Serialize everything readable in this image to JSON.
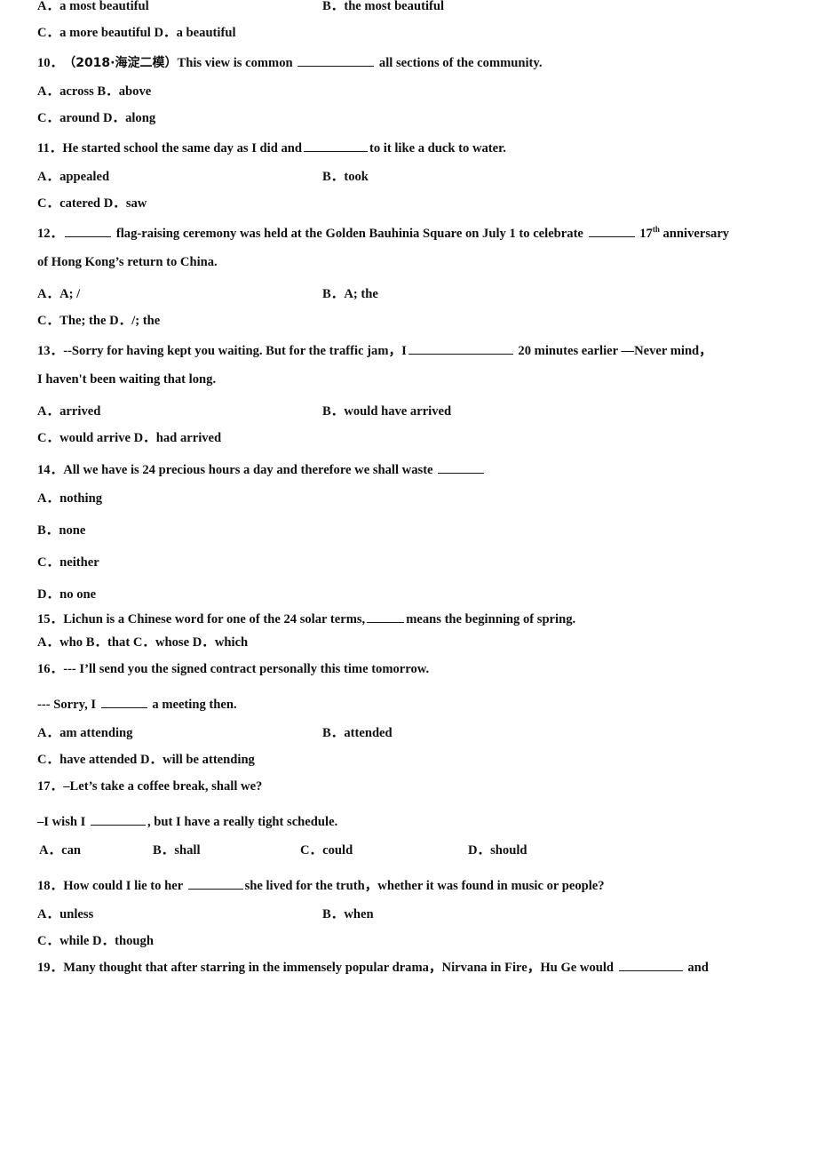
{
  "document": {
    "type": "english-grammar-exam-worksheet",
    "page_background": "#ffffff",
    "text_color": "#111111"
  },
  "rows": [
    {
      "id": "q9-options-ab",
      "kind": "options-two-column",
      "left": "A．a most beautiful",
      "right": "B．the most beautiful"
    },
    {
      "id": "q9-options-cd",
      "kind": "options-inline",
      "text": "C．a more beautiful    D．a beautiful"
    },
    {
      "id": "q10-stem",
      "kind": "question",
      "number": "10．",
      "tag": "（2018·海淀二模）",
      "before": "This view is common ",
      "blank": "b-xl",
      "after": " all sections of the community."
    },
    {
      "id": "q10-options-ab",
      "kind": "options-inline",
      "text": "A．across     B．above"
    },
    {
      "id": "q10-options-cd",
      "kind": "options-inline",
      "text": "C．around     D．along"
    },
    {
      "id": "q11-stem",
      "kind": "question-blank",
      "number": "11．",
      "before": "He started school the same day as I did and",
      "blank": "b-lg",
      "after": "to it like a duck to water."
    },
    {
      "id": "q11-options-ab",
      "kind": "options-two-column",
      "left": "A．appealed",
      "right": "B．took"
    },
    {
      "id": "q11-options-cd",
      "kind": "options-inline",
      "text": "C．catered   D．saw"
    },
    {
      "id": "q12-stem-1",
      "kind": "question-blank-sup",
      "number": "12．",
      "blank1": "b-sm",
      "middle": " flag-raising ceremony was held at the Golden Bauhinia Square on July 1 to celebrate ",
      "blank2": "b-sm",
      "ordinal_number": "17",
      "ordinal_suffix": "th",
      "after": " anniversary"
    },
    {
      "id": "q12-stem-2",
      "kind": "continuation",
      "text": "of Hong Kong’s return to China."
    },
    {
      "id": "q12-options-ab",
      "kind": "options-two-column",
      "left": "A．A; /",
      "right": "B．A; the"
    },
    {
      "id": "q12-options-cd",
      "kind": "options-inline",
      "text": "C．The; the  D．/; the"
    },
    {
      "id": "q13-stem-1",
      "kind": "question-blank",
      "number": "13．",
      "before": "--Sorry for having kept you waiting. But for the traffic jam，I",
      "blank": "b-xxl",
      "after": " 20 minutes earlier —Never mind，"
    },
    {
      "id": "q13-stem-2",
      "kind": "continuation",
      "text": "I haven't been waiting that long."
    },
    {
      "id": "q13-options-ab",
      "kind": "options-two-column",
      "left": "A．arrived",
      "right": "B．would have arrived"
    },
    {
      "id": "q13-options-cd",
      "kind": "options-inline",
      "text": "C．would arrive  D．had arrived"
    },
    {
      "id": "q14-stem",
      "kind": "question-trailing-blank",
      "number": "14．",
      "before": "All we have is 24 precious hours a day and therefore we shall waste ",
      "blank": "b-sm"
    },
    {
      "id": "q14-option-a",
      "kind": "options-inline",
      "text": "A．nothing"
    },
    {
      "id": "q14-option-b",
      "kind": "options-inline",
      "text": "B．none"
    },
    {
      "id": "q14-option-c",
      "kind": "options-inline",
      "text": "C．neither"
    },
    {
      "id": "q14-option-d",
      "kind": "options-inline",
      "text": "D．no one"
    },
    {
      "id": "q15-stem",
      "kind": "question-blank",
      "number": "15．",
      "before": "Lichun is a Chinese word for one of the 24 solar terms,",
      "blank": "b-xs",
      "after": "means the beginning of spring."
    },
    {
      "id": "q15-options",
      "kind": "options-inline",
      "text": "A．who B．that C．whose    D．which"
    },
    {
      "id": "q16-stem-1",
      "kind": "question",
      "number": "16．",
      "before": "--- I’ll send you the signed contract personally this time tomorrow.",
      "blank": null,
      "after": ""
    },
    {
      "id": "q16-stem-2",
      "kind": "continuation-blank",
      "before": "--- Sorry, I ",
      "blank": "b-sm",
      "after": " a meeting then."
    },
    {
      "id": "q16-options-ab",
      "kind": "options-two-column",
      "left": "A．am attending",
      "right": "B．attended"
    },
    {
      "id": "q16-options-cd",
      "kind": "options-inline",
      "text": "C．have attended D．will be attending"
    },
    {
      "id": "q17-stem-1",
      "kind": "question",
      "number": "17．",
      "before": "–Let’s take a coffee break, shall we?",
      "blank": null,
      "after": ""
    },
    {
      "id": "q17-stem-2",
      "kind": "continuation-blank",
      "before": "–I wish I ",
      "blank": "b-md",
      "after": ", but I have a really tight schedule."
    },
    {
      "id": "q17-options",
      "kind": "options-four-column",
      "c1": "A．can",
      "c2": "B．shall",
      "c3": "C．could",
      "c4": "D．should"
    },
    {
      "id": "q18-stem",
      "kind": "question-blank",
      "number": "18．",
      "before": "How could I lie to her  ",
      "blank": "b-md",
      "after": "she lived for the truth，whether it was found in music or people?"
    },
    {
      "id": "q18-options-ab",
      "kind": "options-two-column",
      "left": "A．unless",
      "right": "B．when"
    },
    {
      "id": "q18-options-cd",
      "kind": "options-inline",
      "text": "C．while    D．though"
    },
    {
      "id": "q19-stem",
      "kind": "question-blank",
      "number": "19．",
      "before": "Many thought that after starring in the immensely popular drama，Nirvana in Fire，Hu Ge would ",
      "blank": "b-lg",
      "after": " and"
    }
  ]
}
